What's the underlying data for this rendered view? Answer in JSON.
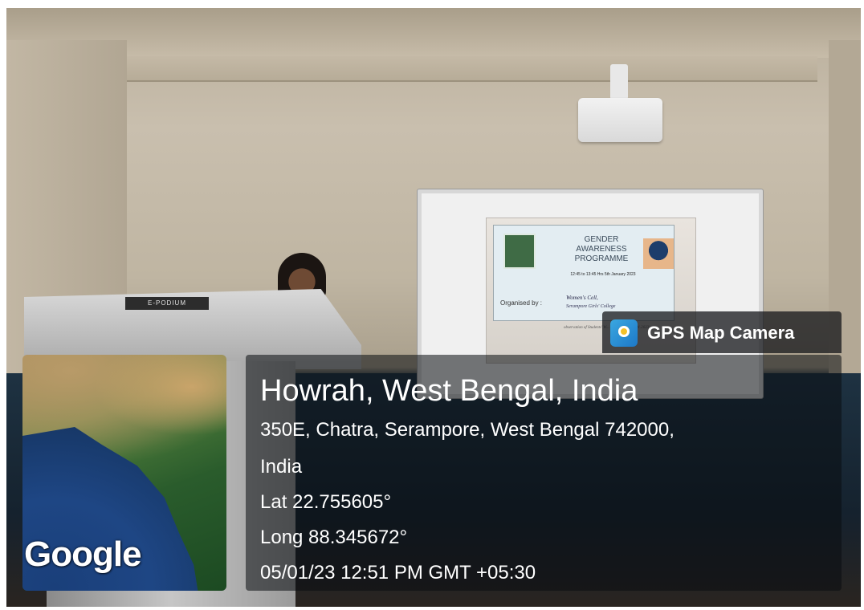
{
  "slide": {
    "title": "GENDER AWARENESS PROGRAMME",
    "time": "12:45 to 13:45 Hrs 5th January 2023",
    "organised_label": "Organised by :",
    "organiser": "Women's Cell,",
    "college": "Serampore Girls' College",
    "footnote": "observation of Students' W... (01.01.2023-07.01.2023)"
  },
  "podium": {
    "label": "E-PODIUM"
  },
  "map": {
    "brand": "Google"
  },
  "overlay": {
    "app_name": "GPS Map Camera",
    "app_icon": "gps-map-camera-icon",
    "place": "Howrah, West Bengal, India",
    "address_line1": "350E, Chatra, Serampore, West Bengal 742000,",
    "address_line2": "India",
    "latitude": "Lat 22.755605°",
    "longitude": "Long 88.345672°",
    "datetime": "05/01/23 12:51 PM GMT +05:30"
  }
}
